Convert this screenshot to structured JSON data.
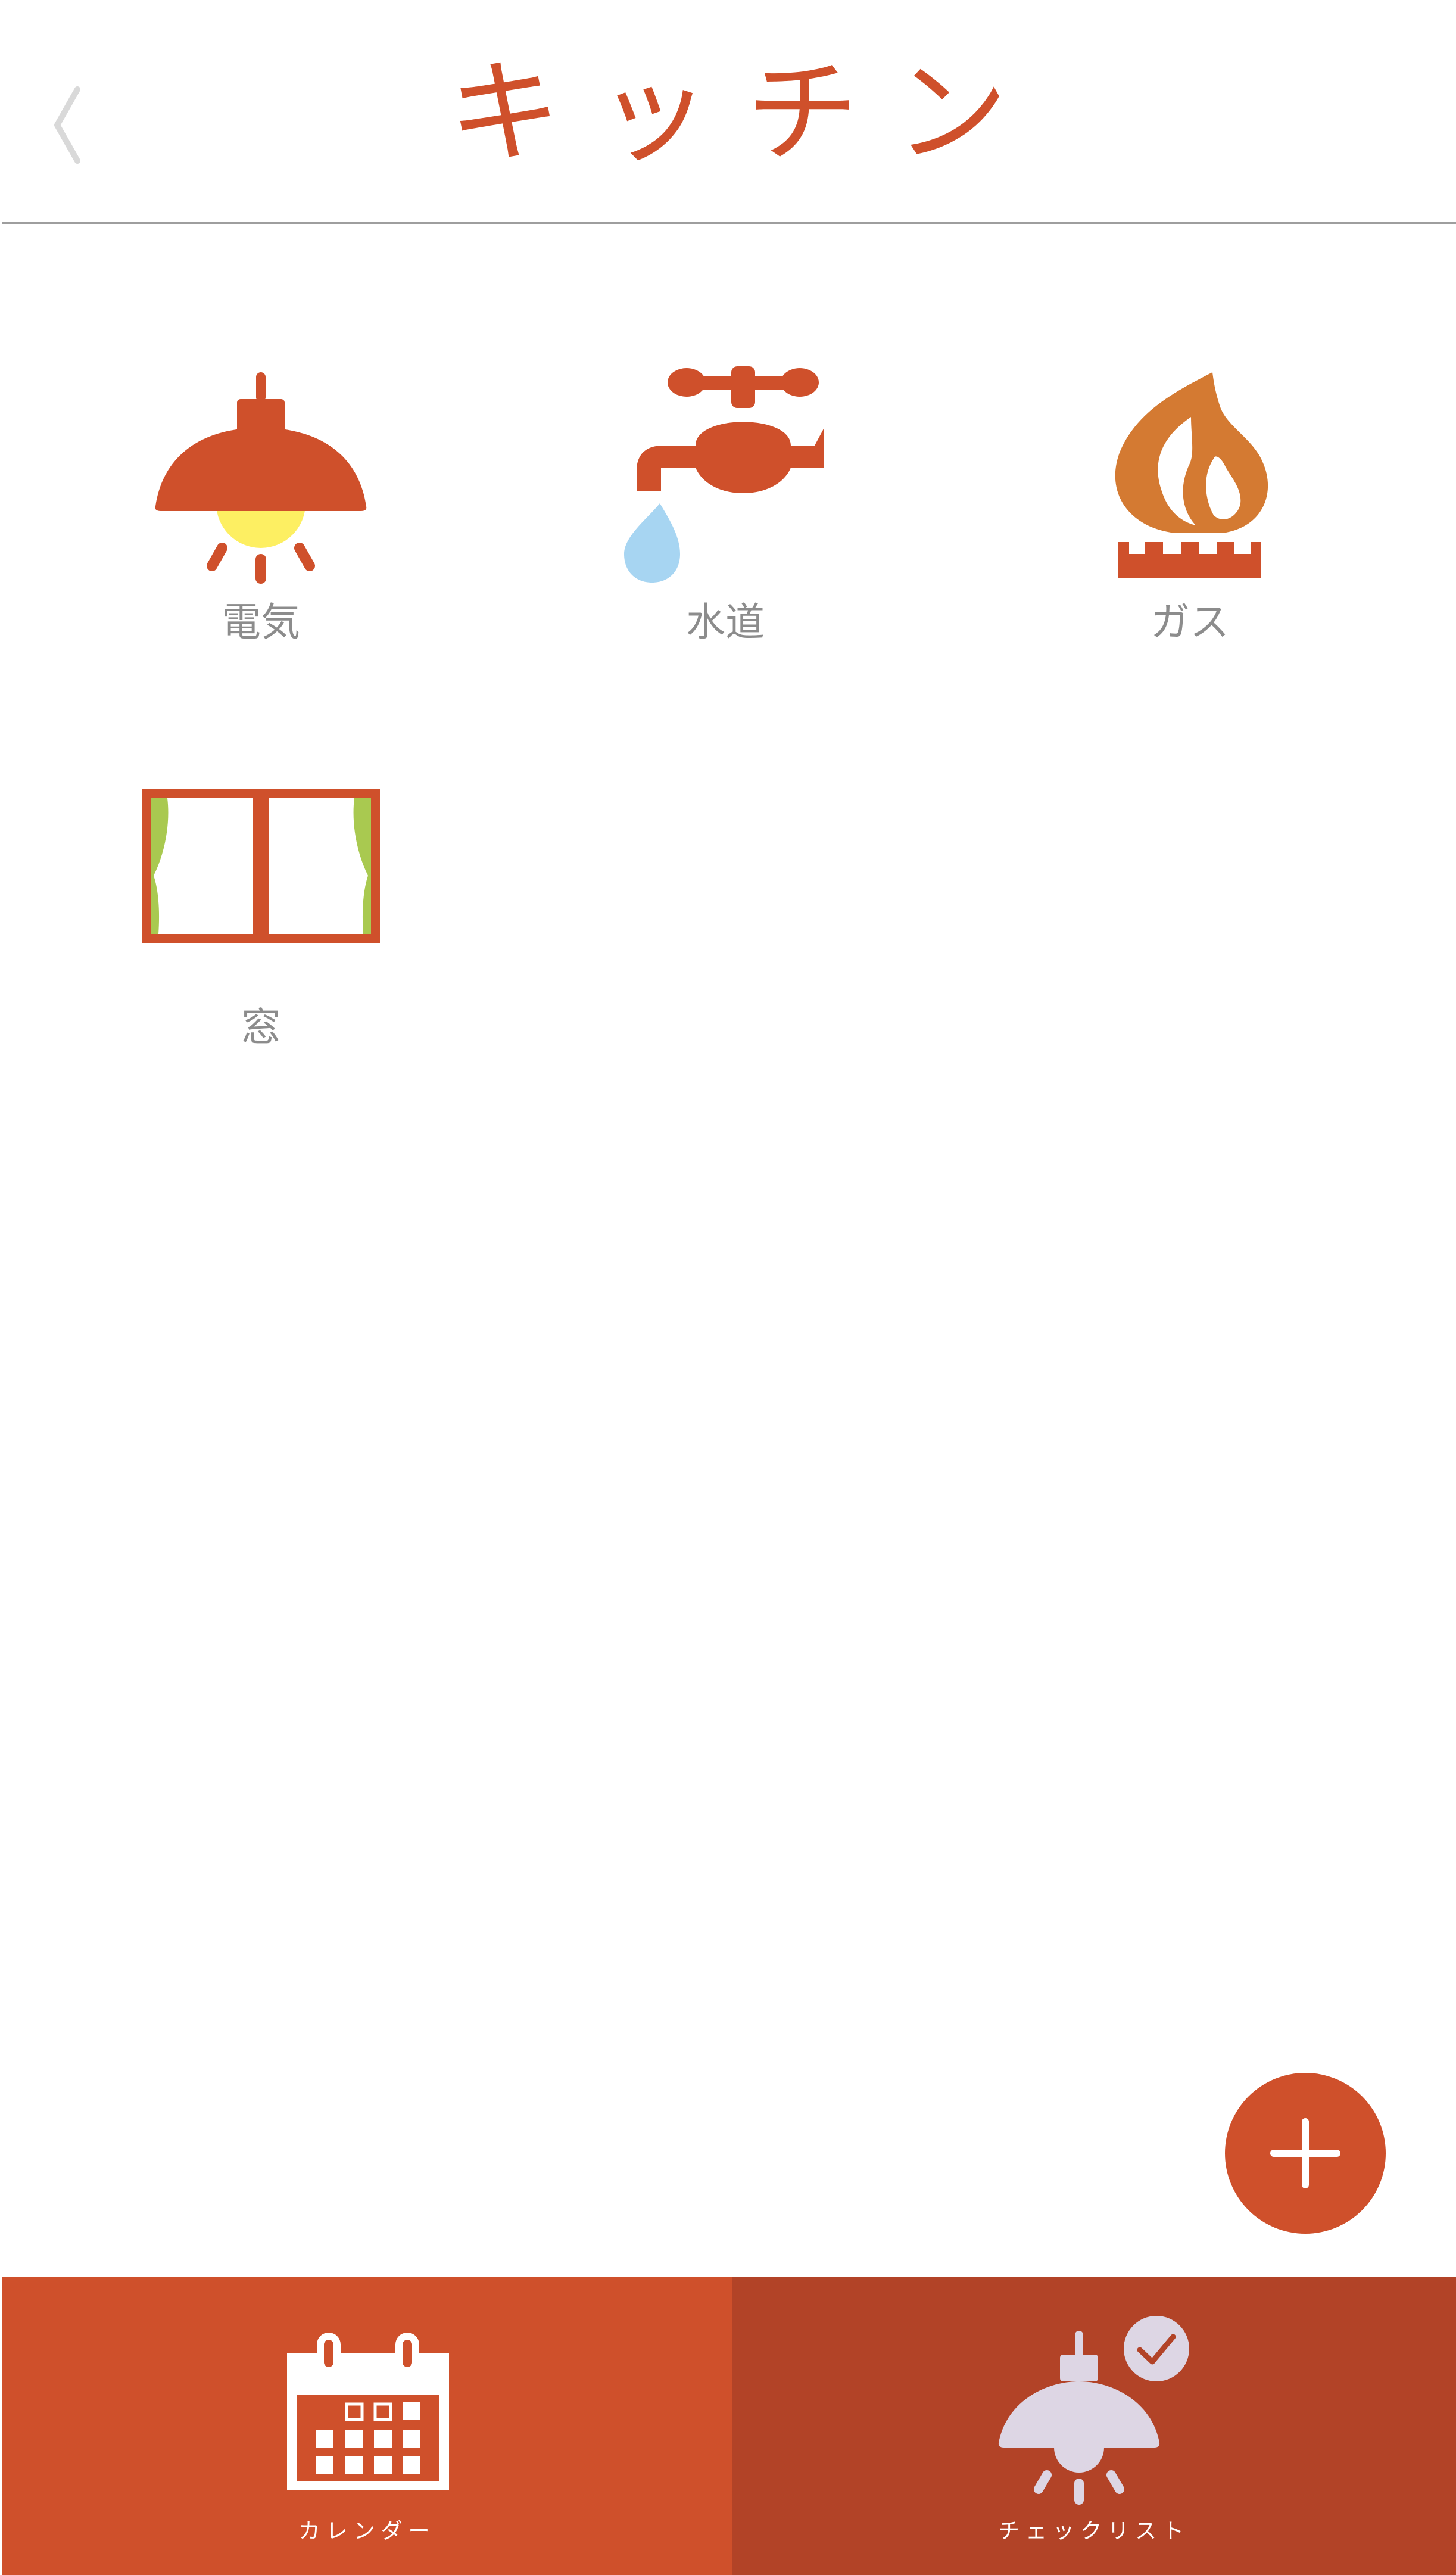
{
  "header": {
    "title": "キッチン",
    "back_icon": "chevron-left-icon"
  },
  "categories": [
    {
      "label": "電気",
      "icon": "ceiling-lamp-icon"
    },
    {
      "label": "水道",
      "icon": "water-faucet-icon"
    },
    {
      "label": "ガス",
      "icon": "gas-flame-icon"
    },
    {
      "label": "窓",
      "icon": "window-curtain-icon"
    }
  ],
  "fab": {
    "icon": "plus-icon"
  },
  "tabbar": {
    "tabs": [
      {
        "label": "カレンダー",
        "icon": "calendar-icon",
        "selected": false
      },
      {
        "label": "チェックリスト",
        "icon": "checklist-lamp-icon",
        "selected": true
      }
    ]
  },
  "colors": {
    "accent": "#cf502b",
    "accent_dark": "#b24327",
    "label_gray": "#8c8c8c",
    "divider": "#9e9e9e",
    "bulb_yellow": "#fdef62",
    "water_blue": "#a7d5f2",
    "flame_orange": "#d47a32",
    "curtain_green": "#a9c950",
    "tab_icon_lavender": "#ddd6e4"
  }
}
